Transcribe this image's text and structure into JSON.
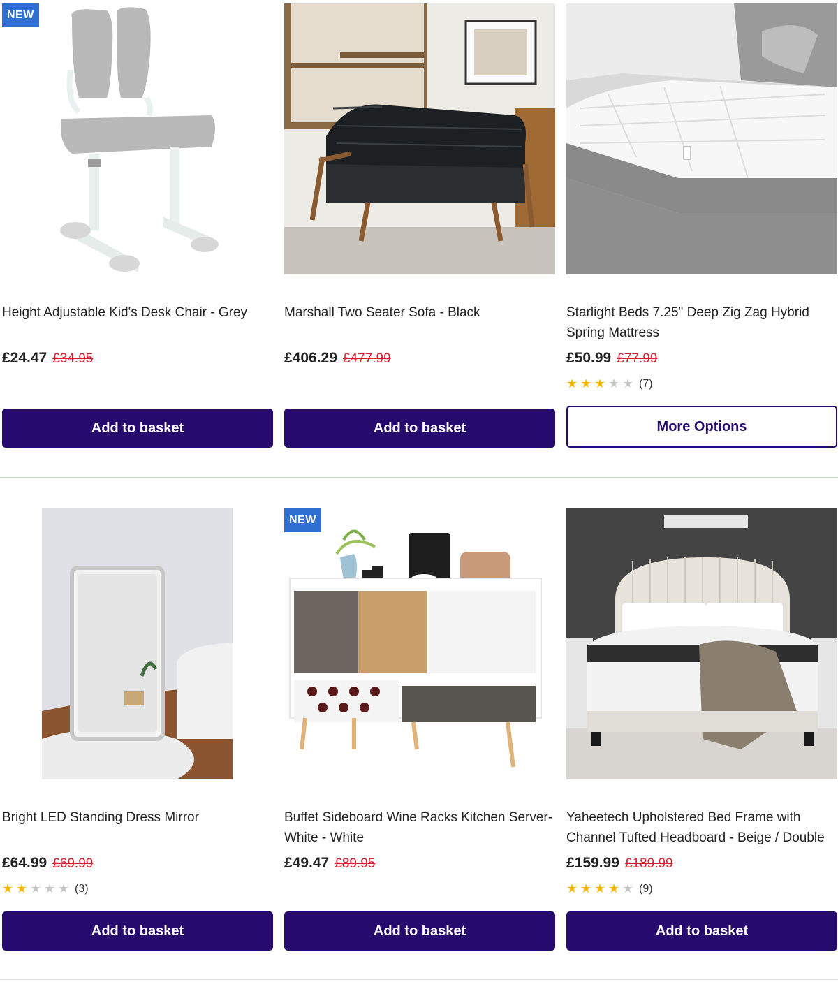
{
  "products": [
    {
      "badge": "NEW",
      "title": "Height Adjustable Kid's Desk Chair - Grey",
      "price": "£24.47",
      "was_price": "£34.95",
      "rating": null,
      "review_count": null,
      "button_label": "Add to basket",
      "button_style": "primary",
      "image_icon": "desk-chair-icon"
    },
    {
      "badge": null,
      "title": "Marshall Two Seater Sofa - Black",
      "price": "£406.29",
      "was_price": "£477.99",
      "rating": null,
      "review_count": null,
      "button_label": "Add to basket",
      "button_style": "primary",
      "image_icon": "sofa-icon"
    },
    {
      "badge": null,
      "title": "Starlight Beds 7.25\" Deep Zig Zag Hybrid Spring Mattress",
      "price": "£50.99",
      "was_price": "£77.99",
      "rating": 3,
      "review_count": "(7)",
      "button_label": "More Options",
      "button_style": "secondary",
      "image_icon": "mattress-icon"
    },
    {
      "badge": null,
      "title": "Bright LED Standing Dress Mirror",
      "price": "£64.99",
      "was_price": "£69.99",
      "rating": 2,
      "review_count": "(3)",
      "button_label": "Add to basket",
      "button_style": "primary",
      "image_icon": "mirror-icon"
    },
    {
      "badge": "NEW",
      "title": "Buffet Sideboard Wine Racks Kitchen Server-White - White",
      "price": "£49.47",
      "was_price": "£89.95",
      "rating": null,
      "review_count": null,
      "button_label": "Add to basket",
      "button_style": "primary",
      "image_icon": "sideboard-icon"
    },
    {
      "badge": null,
      "title": "Yaheetech Upholstered Bed Frame with Channel Tufted Headboard - Beige / Double",
      "price": "£159.99",
      "was_price": "£189.99",
      "rating": 4,
      "review_count": "(9)",
      "button_label": "Add to basket",
      "button_style": "primary",
      "image_icon": "bed-frame-icon"
    }
  ],
  "colors": {
    "primary_button": "#260a6e",
    "was_price": "#d61f2c",
    "badge": "#2f6fd1",
    "star": "#f5b800",
    "divider": "#b9d6c2"
  }
}
